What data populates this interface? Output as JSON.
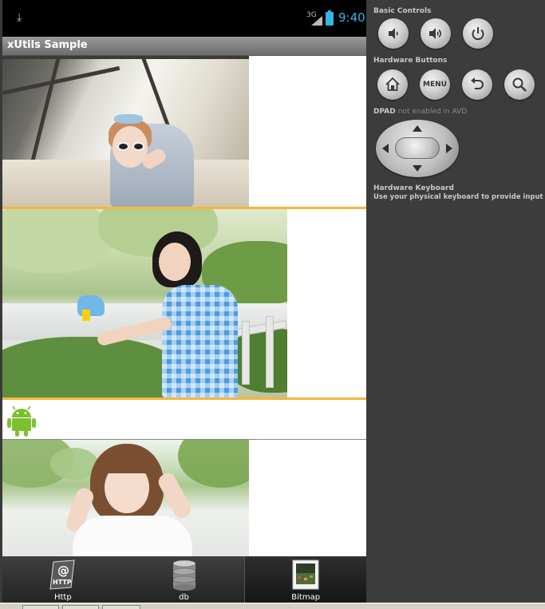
{
  "status_bar": {
    "download_icon": "download-icon",
    "network_label": "3G",
    "time": "9:40",
    "accent_color": "#33b5e5"
  },
  "app": {
    "title": "xUtils Sample"
  },
  "list": {
    "separator_color": "#f6b73c",
    "placeholder_icon": "android-robot-icon"
  },
  "tabs": [
    {
      "label": "Http",
      "icon": "http-icon",
      "selected": false
    },
    {
      "label": "db",
      "icon": "database-icon",
      "selected": false
    },
    {
      "label": "Bitmap",
      "icon": "bitmap-icon",
      "selected": true
    }
  ],
  "emulator": {
    "basic_controls": {
      "heading": "Basic Controls",
      "buttons": [
        "volume-down-icon",
        "volume-up-icon",
        "power-icon"
      ]
    },
    "hardware_buttons": {
      "heading": "Hardware Buttons",
      "buttons": [
        "home-icon",
        "MENU",
        "back-icon",
        "search-icon"
      ]
    },
    "dpad": {
      "heading": "DPAD",
      "note": "not enabled in AVD"
    },
    "hardware_keyboard": {
      "heading": "Hardware Keyboard",
      "note": "Use your physical keyboard to provide input"
    }
  }
}
